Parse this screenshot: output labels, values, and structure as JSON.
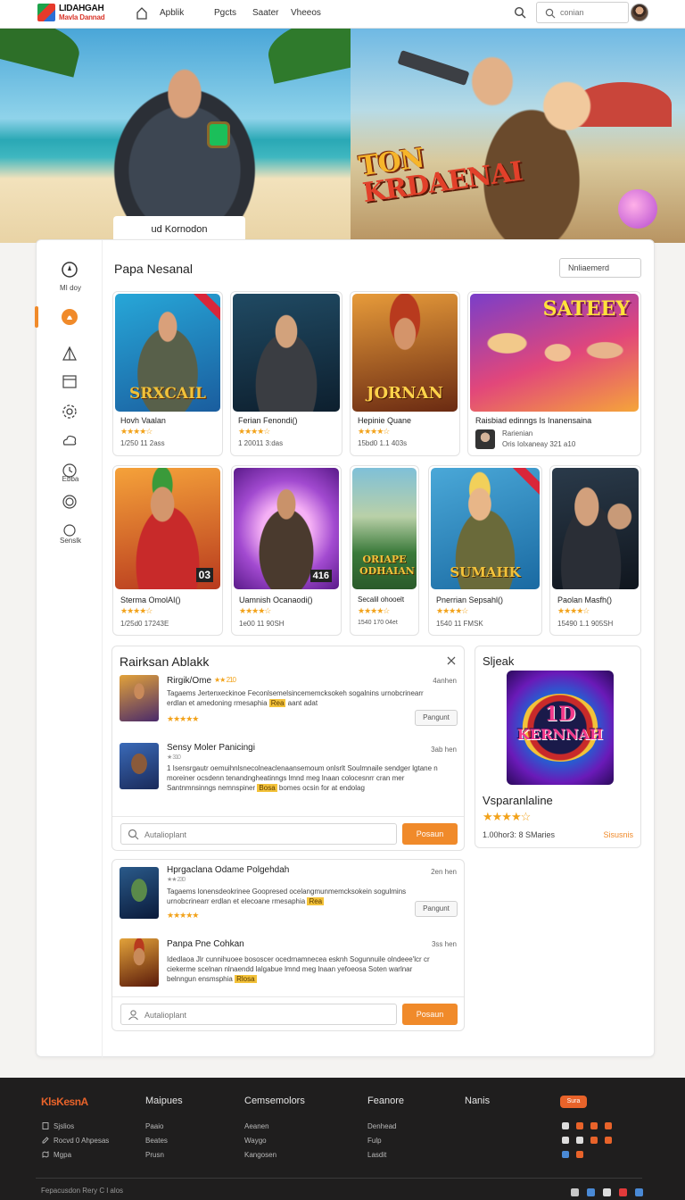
{
  "header": {
    "logo_line1": "LIDAHGAH",
    "logo_line2": "Mavla Dannad",
    "nav": [
      "Apblik",
      "Pgcts",
      "Saater",
      "Vheeos"
    ],
    "search_placeholder": "conian"
  },
  "hero": {
    "title_line1": "TON",
    "title_line2": "KRDAENAI",
    "tab_label": "ud Kornodon"
  },
  "sidebar": {
    "items": [
      {
        "icon": "compass-icon",
        "label": "MI doy"
      },
      {
        "icon": "flame-icon",
        "label": ""
      },
      {
        "icon": "tent-icon",
        "label": ""
      },
      {
        "icon": "calendar-icon",
        "label": ""
      },
      {
        "icon": "gear-icon",
        "label": ""
      },
      {
        "icon": "cloud-icon",
        "label": ""
      },
      {
        "icon": "clock-icon",
        "label": "Ebba"
      },
      {
        "icon": "target-icon",
        "label": ""
      },
      {
        "icon": "circle-icon",
        "label": "Senslk"
      }
    ]
  },
  "games": {
    "section_title": "Papa Nesanal",
    "sort_label": "Nnliaemerd",
    "row1": [
      {
        "name": "Hovh Vaalan",
        "stars": "★★★★☆",
        "meta": "1/250 11 2ass",
        "art": "SRXCAIL"
      },
      {
        "name": "Ferian Fenondi()",
        "stars": "★★★★☆",
        "meta": "1 20011 3:das",
        "art": ""
      },
      {
        "name": "Hepinie Quane",
        "stars": "★★★★☆",
        "meta": "15bd0 1.1 403s",
        "art": "JORNAN"
      },
      {
        "name": "Raisbiad edinngs Is Inanensaina",
        "stars": "",
        "meta": "Oris Iolxaneay 321 a10",
        "sub": "Rarienian",
        "art": "SATEEY"
      }
    ],
    "row2": [
      {
        "name": "Sterma OmolAI()",
        "stars": "★★★★☆",
        "meta": "1/25d0 17243E",
        "art": "03"
      },
      {
        "name": "Uamnish Ocanaodi()",
        "stars": "★★★★☆",
        "meta": "1e00 11 90SH",
        "art": "416"
      },
      {
        "name": "Secalil ohooelt",
        "stars": "★★★★☆",
        "meta": "1540 170 04et",
        "art": "ORIAPE ODHAIAN"
      },
      {
        "name": "Pnerrian Sepsahl()",
        "stars": "★★★★☆",
        "meta": "1540 11 FMSK",
        "art": "SUMAHK"
      },
      {
        "name": "Paolan Masfh()",
        "stars": "★★★★☆",
        "meta": "15490 1.1 905SH",
        "art": ""
      }
    ]
  },
  "reviews": {
    "title": "Rairksan Ablakk",
    "group1": [
      {
        "name": "Rirgik/Ome",
        "inline_rating": "★★ 210",
        "time": "4anhen",
        "text": "Tagaems  Jertenxeckinoe  Feconlsemelsincememcksokeh  sogalnins urnobcrinearr erdlan et amedoning rmesaphia",
        "highlight": "Rea",
        "tail": "aant adat",
        "stars": "★★★★★",
        "button": "Pangunt"
      },
      {
        "name": "Sensy Moler Panicingi",
        "inline_rating": "★ 310",
        "time": "3ab hen",
        "text": "1 Isensrgautr oemuihnlsnecolneaclenaansemoum onlsrlt  Soulmnaile sendger  lgtane n moreiner  ocsdenn tenandngheatinngs  lmnd meg lnaan colocesnrr cran mer Santnmnsinngs nemnspiner",
        "highlight": "Bosa",
        "tail": "bomes ocsin for at endolag"
      }
    ],
    "group2": [
      {
        "name": "Hprgaclana Odame Polgehdah",
        "inline_rating": "★★ 230",
        "time": "2en hen",
        "text": "Tagaems  lonensdeokrinee  Goopresed ocelangmunmemcksokein sogulmins urnobcrinearr erdlan et elecoane rmesaphia",
        "highlight": "Rea",
        "tail": "",
        "stars": "★★★★★",
        "button": "Pangunt"
      },
      {
        "name": "Panpa Pne Cohkan",
        "inline_rating": "",
        "time": "3ss hen",
        "text": "Idedlaoa Jlr cunnihuoee bososcer ocedrnamnecea esknh  Sogunnuile olndeee'lcr cr ciekerme  scelnan nlnaendd lalgabue  lmnd meg lnaan yefoeosa Soten warlnar belnngun ensmsphia",
        "highlight": "Rlosa",
        "tail": ""
      }
    ],
    "reply_placeholder": "Autalioplant",
    "post_label": "Posaun"
  },
  "side_panel": {
    "title": "Sljeak",
    "art_line1": "1D",
    "art_line2": "KERNNAH",
    "game_name": "Vsparanlaline",
    "stars": "★★★★☆",
    "meta": "1.00hor3: 8 SMaries",
    "link": "Sisusnis"
  },
  "footer": {
    "logo": "KlsKesnA",
    "columns": [
      {
        "head": "Maipues",
        "links": [
          "Paaio",
          "Beates",
          "Prusn"
        ]
      },
      {
        "head": "Cemsemolors",
        "links": [
          "Aeanen",
          "Waygo",
          "Kangosen"
        ]
      },
      {
        "head": "Feanore",
        "links": [
          "Denhead",
          "Fulp",
          "Lasdit"
        ]
      },
      {
        "head": "Nanis",
        "links": []
      }
    ],
    "left_links": [
      "Sjslios",
      "Rocvd 0 Ahpesas",
      "Mgpa"
    ],
    "pill": "Sura",
    "copyright": "Fepacusdon  Rery  C  l alos"
  },
  "colors": {
    "accent": "#f08a2a",
    "star": "#f2a21a",
    "footer_bg": "#1f1e1e"
  }
}
